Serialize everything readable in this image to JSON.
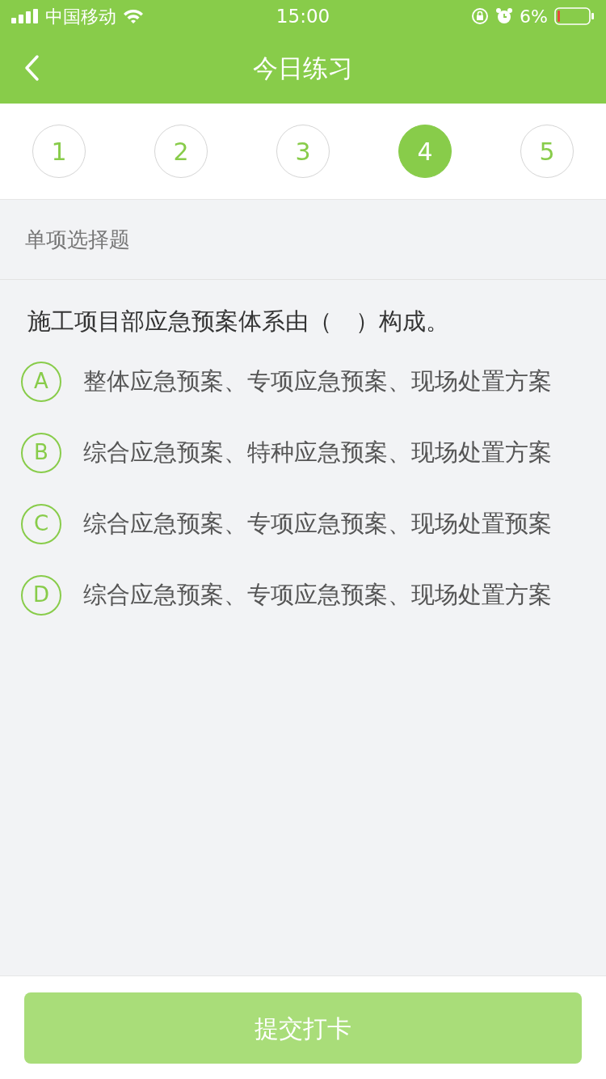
{
  "status_bar": {
    "carrier": "中国移动",
    "time": "15:00",
    "battery": "6%"
  },
  "nav": {
    "title": "今日练习"
  },
  "question_numbers": [
    {
      "label": "1",
      "selected": false
    },
    {
      "label": "2",
      "selected": false
    },
    {
      "label": "3",
      "selected": false
    },
    {
      "label": "4",
      "selected": true
    },
    {
      "label": "5",
      "selected": false
    }
  ],
  "section_title": "单项选择题",
  "question": "施工项目部应急预案体系由（　）构成。",
  "options": [
    {
      "letter": "A",
      "text": "整体应急预案、专项应急预案、现场处置方案"
    },
    {
      "letter": "B",
      "text": "综合应急预案、特种应急预案、现场处置方案"
    },
    {
      "letter": "C",
      "text": "综合应急预案、专项应急预案、现场处置预案"
    },
    {
      "letter": "D",
      "text": "综合应急预案、专项应急预案、现场处置方案"
    }
  ],
  "submit": {
    "label": "提交打卡",
    "disabled": true
  }
}
